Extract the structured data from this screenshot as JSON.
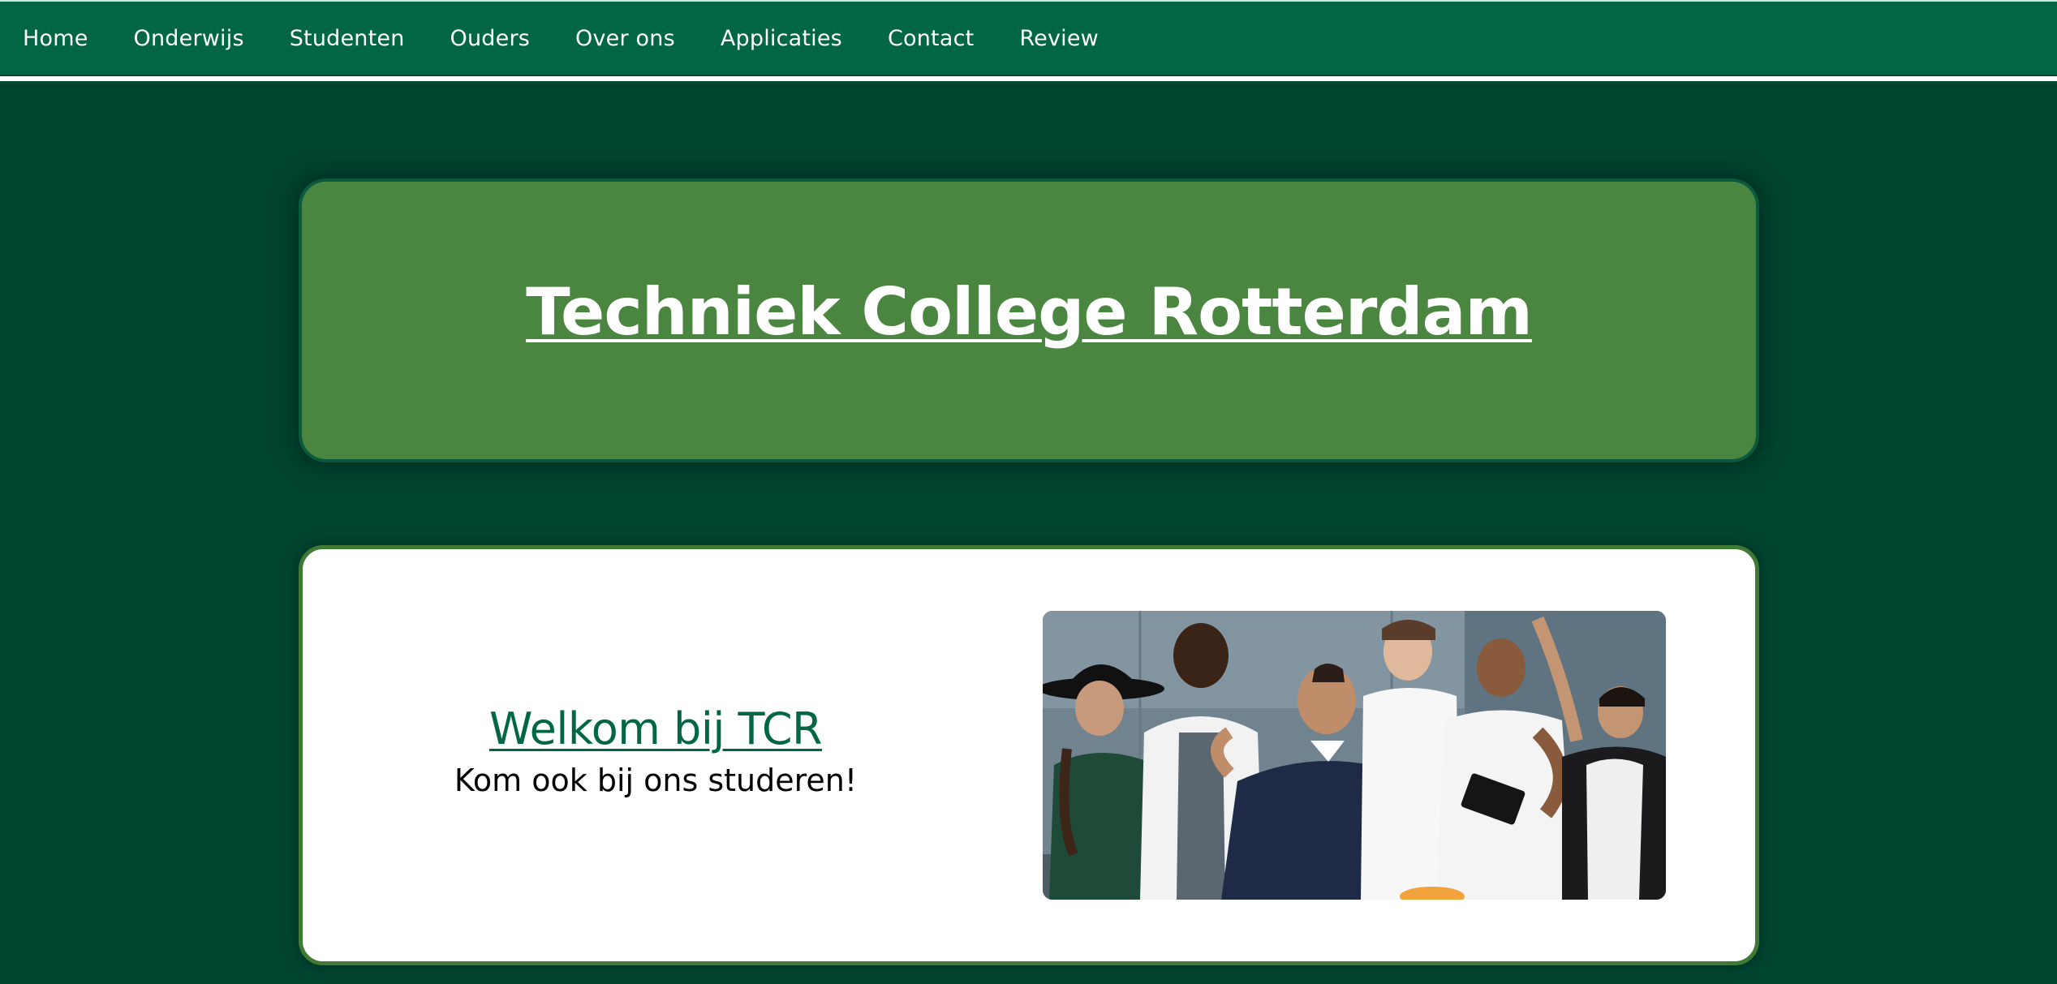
{
  "nav": {
    "items": [
      {
        "label": "Home"
      },
      {
        "label": "Onderwijs"
      },
      {
        "label": "Studenten"
      },
      {
        "label": "Ouders"
      },
      {
        "label": "Over ons"
      },
      {
        "label": "Applicaties"
      },
      {
        "label": "Contact"
      },
      {
        "label": "Review"
      }
    ]
  },
  "hero": {
    "title": "Techniek College Rotterdam"
  },
  "welcome": {
    "heading": "Welkom bij TCR",
    "subheading": "Kom ook bij ons studeren!"
  },
  "colors": {
    "page_background": "#004530",
    "nav_background": "#006644",
    "hero_background": "#4a863f",
    "welcome_background": "#ffffff",
    "welcome_heading": "#006644"
  }
}
